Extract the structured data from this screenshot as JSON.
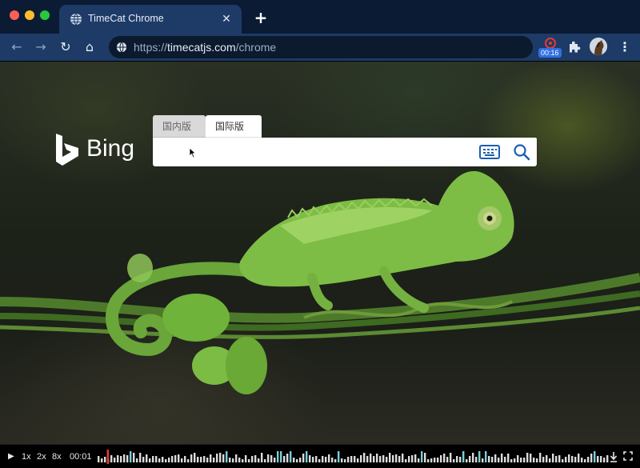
{
  "window": {
    "tab": {
      "title": "TimeCat Chrome",
      "close_label": "✕"
    },
    "new_tab_label": "+"
  },
  "toolbar": {
    "back_label": "←",
    "forward_label": "→",
    "reload_label": "↻",
    "home_label": "⌂",
    "url": {
      "scheme": "https://",
      "host": "timecatjs.com",
      "path": "/chrome"
    },
    "recording_time": "00:16",
    "menu_label": "⋮"
  },
  "bing": {
    "brand": "Bing",
    "tabs": [
      {
        "label": "国内版",
        "active": false
      },
      {
        "label": "国际版",
        "active": true
      }
    ],
    "search_value": ""
  },
  "player": {
    "play_label": "▶",
    "speeds": [
      "1x",
      "2x",
      "8x"
    ],
    "current_time": "00:01",
    "playhead_fraction": 0.018
  },
  "colors": {
    "tabbar_bg": "#0b1b33",
    "toolbar_bg": "#1d3b66",
    "bing_icon_blue": "#1a5eaf",
    "record_red": "#e53935",
    "record_badge": "#2f6fe0",
    "playhead_red": "#e53935",
    "timeline_marker": "#7ad0d6"
  }
}
